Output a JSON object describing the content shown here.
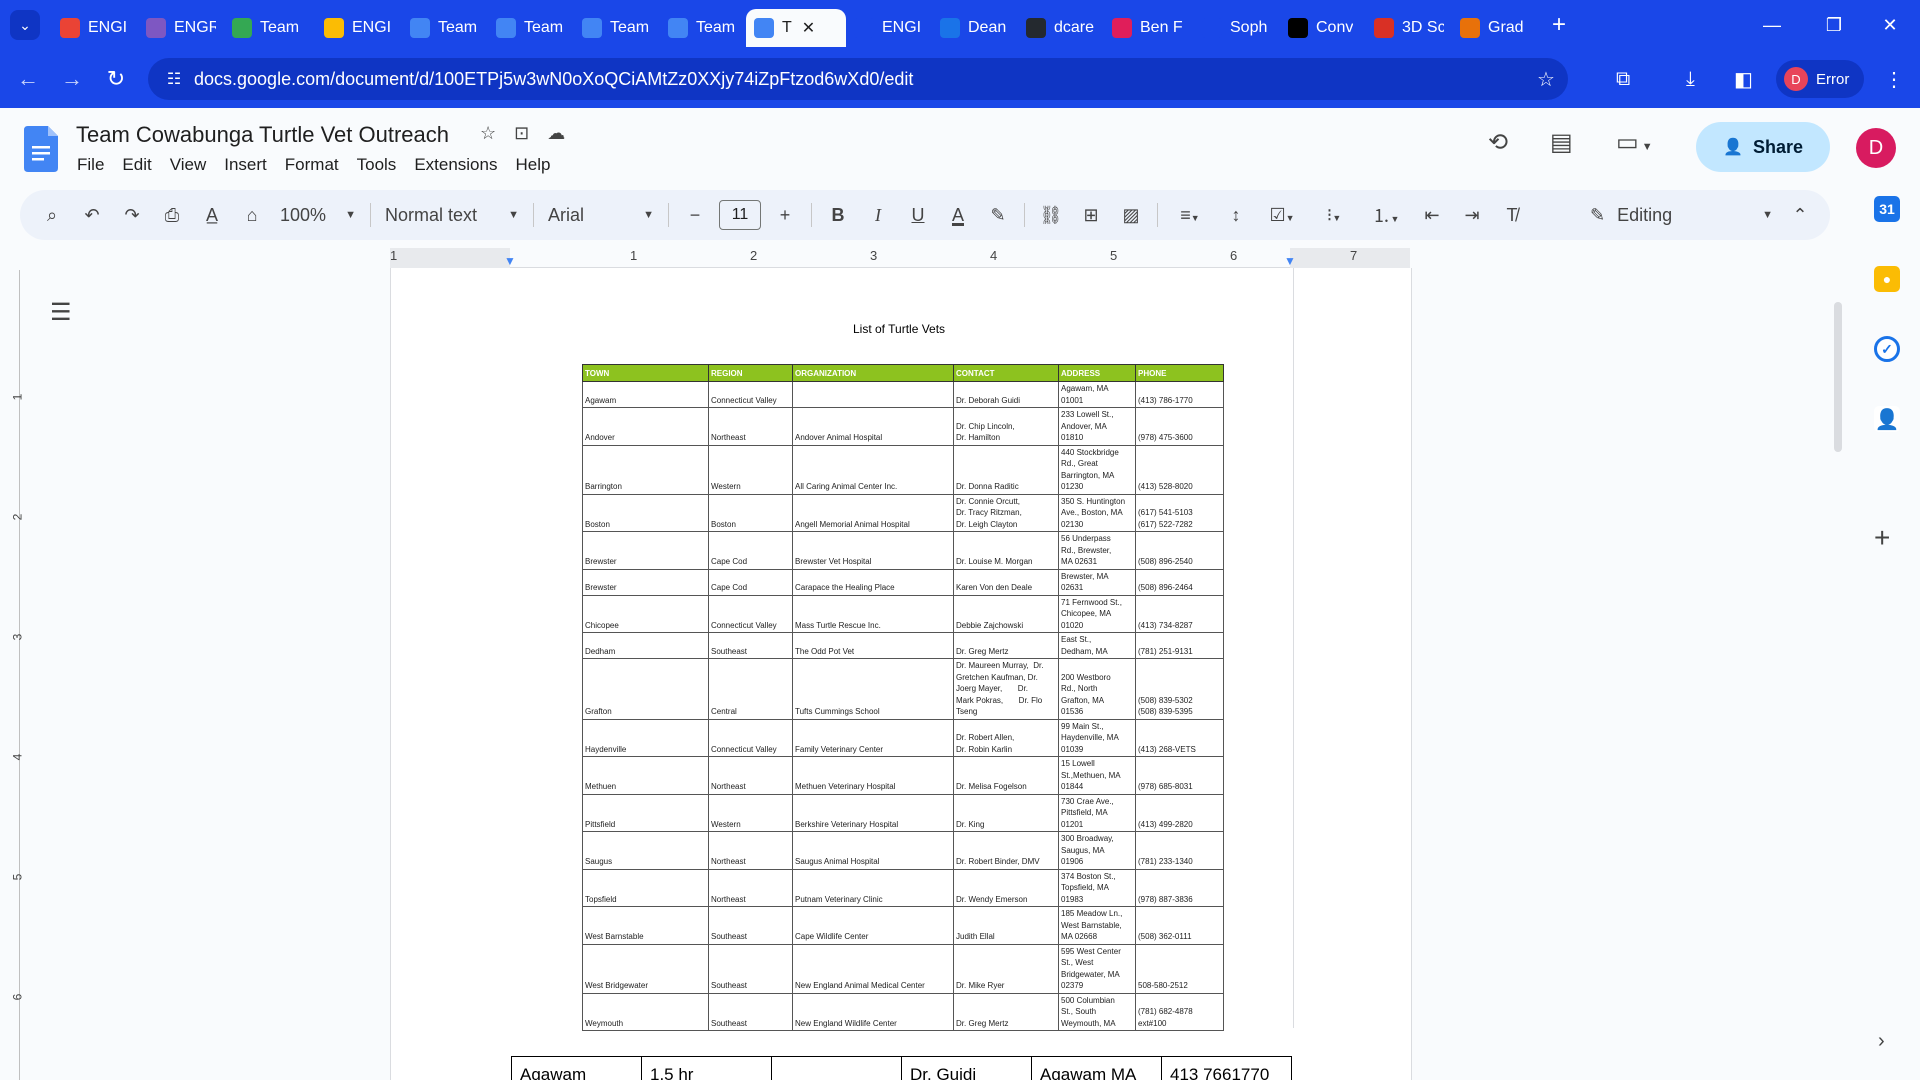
{
  "browser": {
    "tabs": [
      {
        "label": "ENGI",
        "favicon": "gmail-icon",
        "color": "#ea4335"
      },
      {
        "label": "ENGR",
        "favicon": "forms-icon",
        "color": "#7e57c2"
      },
      {
        "label": "Team",
        "favicon": "drive-icon",
        "color": "#34a853"
      },
      {
        "label": "ENGI",
        "favicon": "slides-icon",
        "color": "#fbbc04"
      },
      {
        "label": "Team",
        "favicon": "docs-icon",
        "color": "#4285f4"
      },
      {
        "label": "Team",
        "favicon": "docs-icon",
        "color": "#4285f4"
      },
      {
        "label": "Team",
        "favicon": "docs-icon",
        "color": "#4285f4"
      },
      {
        "label": "Team",
        "favicon": "docs-icon",
        "color": "#4285f4"
      },
      {
        "label": "T",
        "favicon": "docs-icon",
        "color": "#4285f4",
        "active": true
      },
      {
        "label": "ENGI",
        "favicon": "blank-icon",
        "color": "#1a47e8"
      },
      {
        "label": "Dean",
        "favicon": "classroom-icon",
        "color": "#1a73e8"
      },
      {
        "label": "dcare",
        "favicon": "github-icon",
        "color": "#24292f"
      },
      {
        "label": "Ben F",
        "favicon": "slack-icon",
        "color": "#e01e5a"
      },
      {
        "label": "Soph",
        "favicon": "globe-icon",
        "color": "#1a47e8"
      },
      {
        "label": "Conv",
        "favicon": "h-icon",
        "color": "#000000"
      },
      {
        "label": "3D Sc",
        "favicon": "d-icon",
        "color": "#d93025"
      },
      {
        "label": "Grad",
        "favicon": "in-icon",
        "color": "#e8710a"
      }
    ],
    "new_tab_label": "+",
    "url": "docs.google.com/document/d/100ETPj5w3wN0oXoQCiAMtZz0XXjy74iZpFtzod6wXd0/edit",
    "profile_initial": "D",
    "profile_status": "Error"
  },
  "doc": {
    "title": "Team Cowabunga Turtle Vet Outreach",
    "menu": [
      "File",
      "Edit",
      "View",
      "Insert",
      "Format",
      "Tools",
      "Extensions",
      "Help"
    ],
    "share_label": "Share",
    "user_initial": "D"
  },
  "toolbar": {
    "zoom": "100%",
    "style": "Normal text",
    "font": "Arial",
    "font_size": "11",
    "mode": "Editing"
  },
  "ruler": {
    "h_numbers": [
      "1",
      "1",
      "2",
      "3",
      "4",
      "5",
      "6",
      "7"
    ],
    "v_numbers": [
      "1",
      "2",
      "3",
      "4",
      "5",
      "6"
    ]
  },
  "content": {
    "pdf_title": "List of Turtle Vets",
    "headers": [
      "TOWN",
      "REGION",
      "ORGANIZATION",
      "CONTACT",
      "ADDRESS",
      "PHONE"
    ],
    "rows": [
      [
        "Agawam",
        "Connecticut Valley",
        "",
        "Dr. Deborah Guidi",
        "Agawam, MA\n01001",
        "(413) 786-1770"
      ],
      [
        "Andover",
        "Northeast",
        "Andover Animal Hospital",
        "Dr. Chip Lincoln,\nDr. Hamilton",
        "233 Lowell St.,\nAndover, MA\n01810",
        "(978) 475-3600"
      ],
      [
        "Barrington",
        "Western",
        "All Caring Animal Center Inc.",
        "Dr. Donna Raditic",
        "440 Stockbridge\nRd., Great\nBarrington, MA\n01230",
        "(413) 528-8020"
      ],
      [
        "Boston",
        "Boston",
        "Angell Memorial Animal Hospital",
        "Dr. Connie Orcutt,\nDr. Tracy Ritzman,\nDr. Leigh Clayton",
        "350 S. Huntington\nAve., Boston, MA\n02130",
        "(617) 541-5103\n(617) 522-7282"
      ],
      [
        "Brewster",
        "Cape Cod",
        "Brewster Vet Hospital",
        "Dr. Louise M. Morgan",
        "56 Underpass\nRd., Brewster,\nMA 02631",
        "(508) 896-2540"
      ],
      [
        "Brewster",
        "Cape Cod",
        "Carapace the Healing Place",
        "Karen Von den Deale",
        "Brewster, MA\n02631",
        "(508) 896-2464"
      ],
      [
        "Chicopee",
        "Connecticut Valley",
        "Mass Turtle Rescue Inc.",
        "Debbie Zajchowski",
        "71 Fernwood St.,\nChicopee, MA\n01020",
        "(413) 734-8287"
      ],
      [
        "Dedham",
        "Southeast",
        "The Odd Pot Vet",
        "Dr. Greg Mertz",
        "East St.,\nDedham, MA",
        "(781) 251-9131"
      ],
      [
        "Grafton",
        "Central",
        "Tufts Cummings School",
        "Dr. Maureen Murray,  Dr.\nGretchen Kaufman, Dr.\nJoerg Mayer,       Dr.\nMark Pokras,       Dr. Flo\nTseng",
        "200 Westboro\nRd., North\nGrafton, MA\n01536",
        "(508) 839-5302\n(508) 839-5395"
      ],
      [
        "Haydenville",
        "Connecticut Valley",
        "Family Veterinary Center",
        "Dr. Robert Allen,\nDr. Robin Karlin",
        "99 Main St.,\nHaydenville, MA\n01039",
        "(413) 268-VETS"
      ],
      [
        "Methuen",
        "Northeast",
        "Methuen Veterinary Hospital",
        "Dr. Melisa Fogelson",
        "15 Lowell\nSt.,Methuen, MA\n01844",
        "(978) 685-8031"
      ],
      [
        "Pittsfield",
        "Western",
        "Berkshire Veterinary Hospital",
        "Dr. King",
        "730 Crae Ave.,\nPittsfield, MA\n01201",
        "(413) 499-2820"
      ],
      [
        "Saugus",
        "Northeast",
        "Saugus Animal Hospital",
        "Dr. Robert Binder, DMV",
        "300 Broadway,\nSaugus, MA\n01906",
        "(781) 233-1340"
      ],
      [
        "Topsfield",
        "Northeast",
        "Putnam Veterinary Clinic",
        "Dr. Wendy Emerson",
        "374 Boston St.,\nTopsfield, MA\n01983",
        "(978) 887-3836"
      ],
      [
        "West Barnstable",
        "Southeast",
        "Cape Wildlife Center",
        "Judith Ellal",
        "185 Meadow Ln.,\nWest Barnstable,\nMA 02668",
        "(508) 362-0111"
      ],
      [
        "West Bridgewater",
        "Southeast",
        "New England Animal Medical Center",
        "Dr. Mike Ryer",
        "595 West Center\nSt., West\nBridgewater, MA\n02379",
        "508-580-2512"
      ],
      [
        "Weymouth",
        "Southeast",
        "New England Wildlife Center",
        "Dr. Greg Mertz",
        "500 Columbian\nSt., South\nWeymouth, MA",
        "(781) 682-4878\next#100"
      ]
    ],
    "lower_table_first_row": [
      "Agawam",
      "1.5 hr",
      "",
      "Dr. Guidi",
      "Agawam MA",
      "413 7661770"
    ]
  }
}
